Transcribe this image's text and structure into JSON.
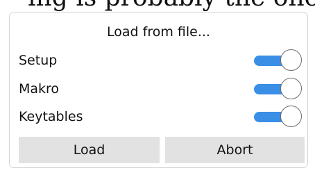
{
  "background_text": "ing is probably the one you",
  "dialog": {
    "title": "Load from file...",
    "options": [
      {
        "label": "Setup",
        "enabled": true
      },
      {
        "label": "Makro",
        "enabled": true
      },
      {
        "label": "Keytables",
        "enabled": true
      }
    ],
    "buttons": {
      "load_label": "Load",
      "abort_label": "Abort"
    },
    "colors": {
      "toggle_on": "#3b8ee6",
      "button_bg": "#e2e2e2"
    }
  }
}
